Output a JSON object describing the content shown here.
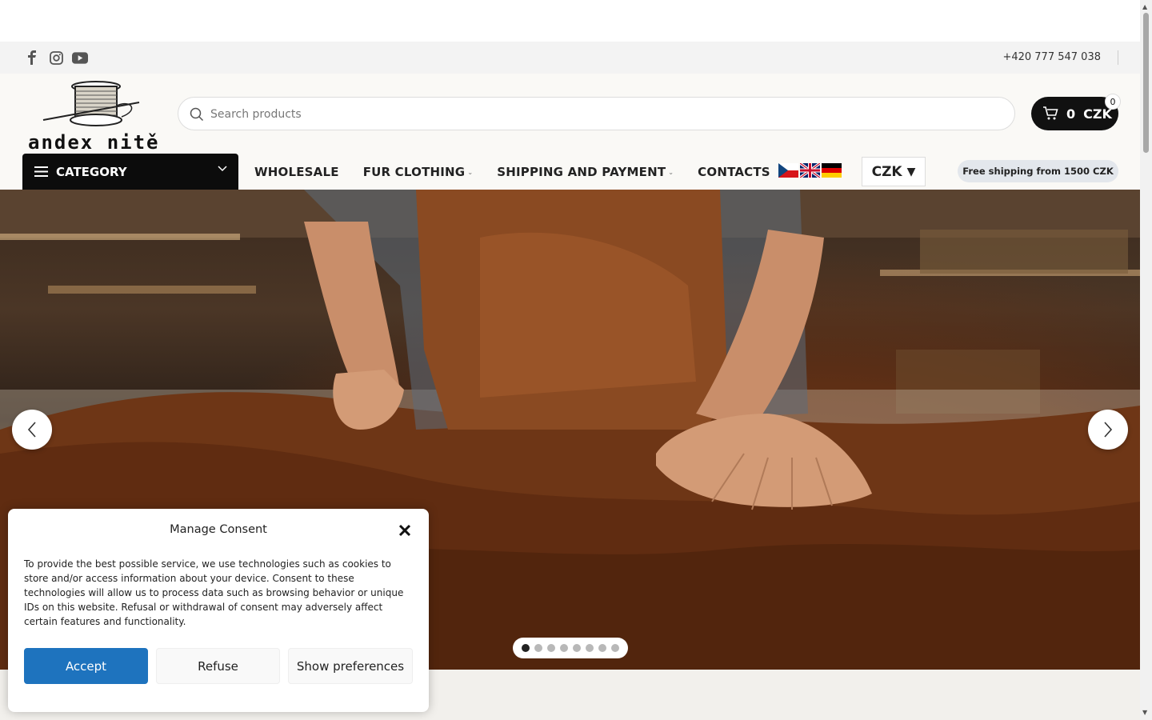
{
  "topbar": {
    "social_icons": [
      "facebook-icon",
      "instagram-icon",
      "youtube-icon"
    ],
    "phone": "+420 777 547 038"
  },
  "header": {
    "logo_text": "andex nitě",
    "search": {
      "placeholder": "Search products",
      "value": ""
    },
    "cart": {
      "amount": "0",
      "currency": "CZK",
      "count": "0"
    }
  },
  "nav": {
    "category_label": "CATEGORY",
    "items": [
      {
        "label": "WHOLESALE",
        "has_dropdown": false
      },
      {
        "label": "FUR CLOTHING",
        "has_dropdown": true
      },
      {
        "label": "SHIPPING AND PAYMENT",
        "has_dropdown": true
      },
      {
        "label": "CONTACTS",
        "has_dropdown": false
      }
    ],
    "languages": [
      "cz-flag-icon",
      "uk-flag-icon",
      "de-flag-icon"
    ],
    "currency": "CZK",
    "shipping_badge": "Free shipping from 1500 CZK"
  },
  "hero": {
    "slide_count": 8,
    "active_slide": 1
  },
  "consent": {
    "title": "Manage Consent",
    "text": "To provide the best possible service, we use technologies such as cookies to store and/or access information about your device. Consent to these technologies will allow us to process data such as browsing behavior or unique IDs on this website. Refusal or withdrawal of consent may adversely affect certain features and functionality.",
    "accept_label": "Accept",
    "refuse_label": "Refuse",
    "preferences_label": "Show preferences"
  },
  "colors": {
    "accent": "#1e73be",
    "dark": "#0c0c0c",
    "topbar": "#f3f3f3",
    "header": "#faf9f6"
  }
}
